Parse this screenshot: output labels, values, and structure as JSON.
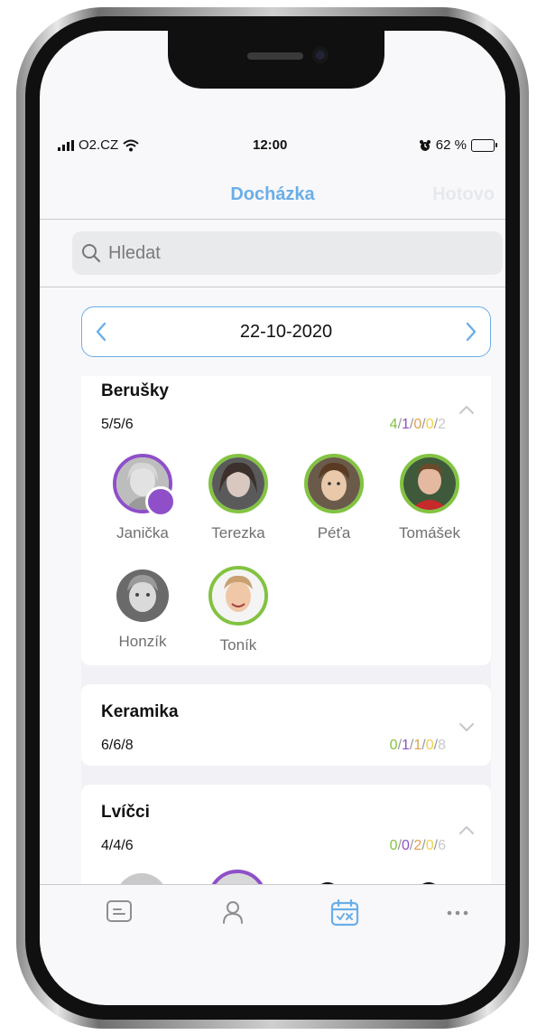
{
  "status": {
    "carrier": "O2.CZ",
    "time": "12:00",
    "battery": "62 %",
    "battery_level": 0.62
  },
  "nav": {
    "title": "Docházka",
    "done": "Hotovo"
  },
  "search": {
    "placeholder": "Hledat"
  },
  "date": {
    "value": "22-10-2020"
  },
  "groups": [
    {
      "name": "Berušky",
      "counts": "5/5/6",
      "stats": [
        "4",
        "1",
        "0",
        "0",
        "2"
      ],
      "expanded": true,
      "children": [
        {
          "name": "Janička",
          "ring": "purple"
        },
        {
          "name": "Terezka",
          "ring": "green"
        },
        {
          "name": "Péťa",
          "ring": "green"
        },
        {
          "name": "Tomášek",
          "ring": "green"
        },
        {
          "name": "Honzík",
          "ring": "none"
        },
        {
          "name": "Toník",
          "ring": "green"
        }
      ]
    },
    {
      "name": "Keramika",
      "counts": "6/6/8",
      "stats": [
        "0",
        "1",
        "1",
        "0",
        "8"
      ],
      "expanded": false
    },
    {
      "name": "Lvíčci",
      "counts": "4/4/6",
      "stats": [
        "0",
        "0",
        "2",
        "0",
        "6"
      ],
      "expanded": true
    }
  ],
  "colors": {
    "accent": "#6aaee8",
    "present": "#82c341",
    "excused": "#8e4fc8",
    "absent": "#e0a050",
    "late": "#f2d04a",
    "total": "#c8c8c8"
  },
  "tabs": [
    "feed-icon",
    "person-icon",
    "calendar-check-icon",
    "more-icon"
  ]
}
